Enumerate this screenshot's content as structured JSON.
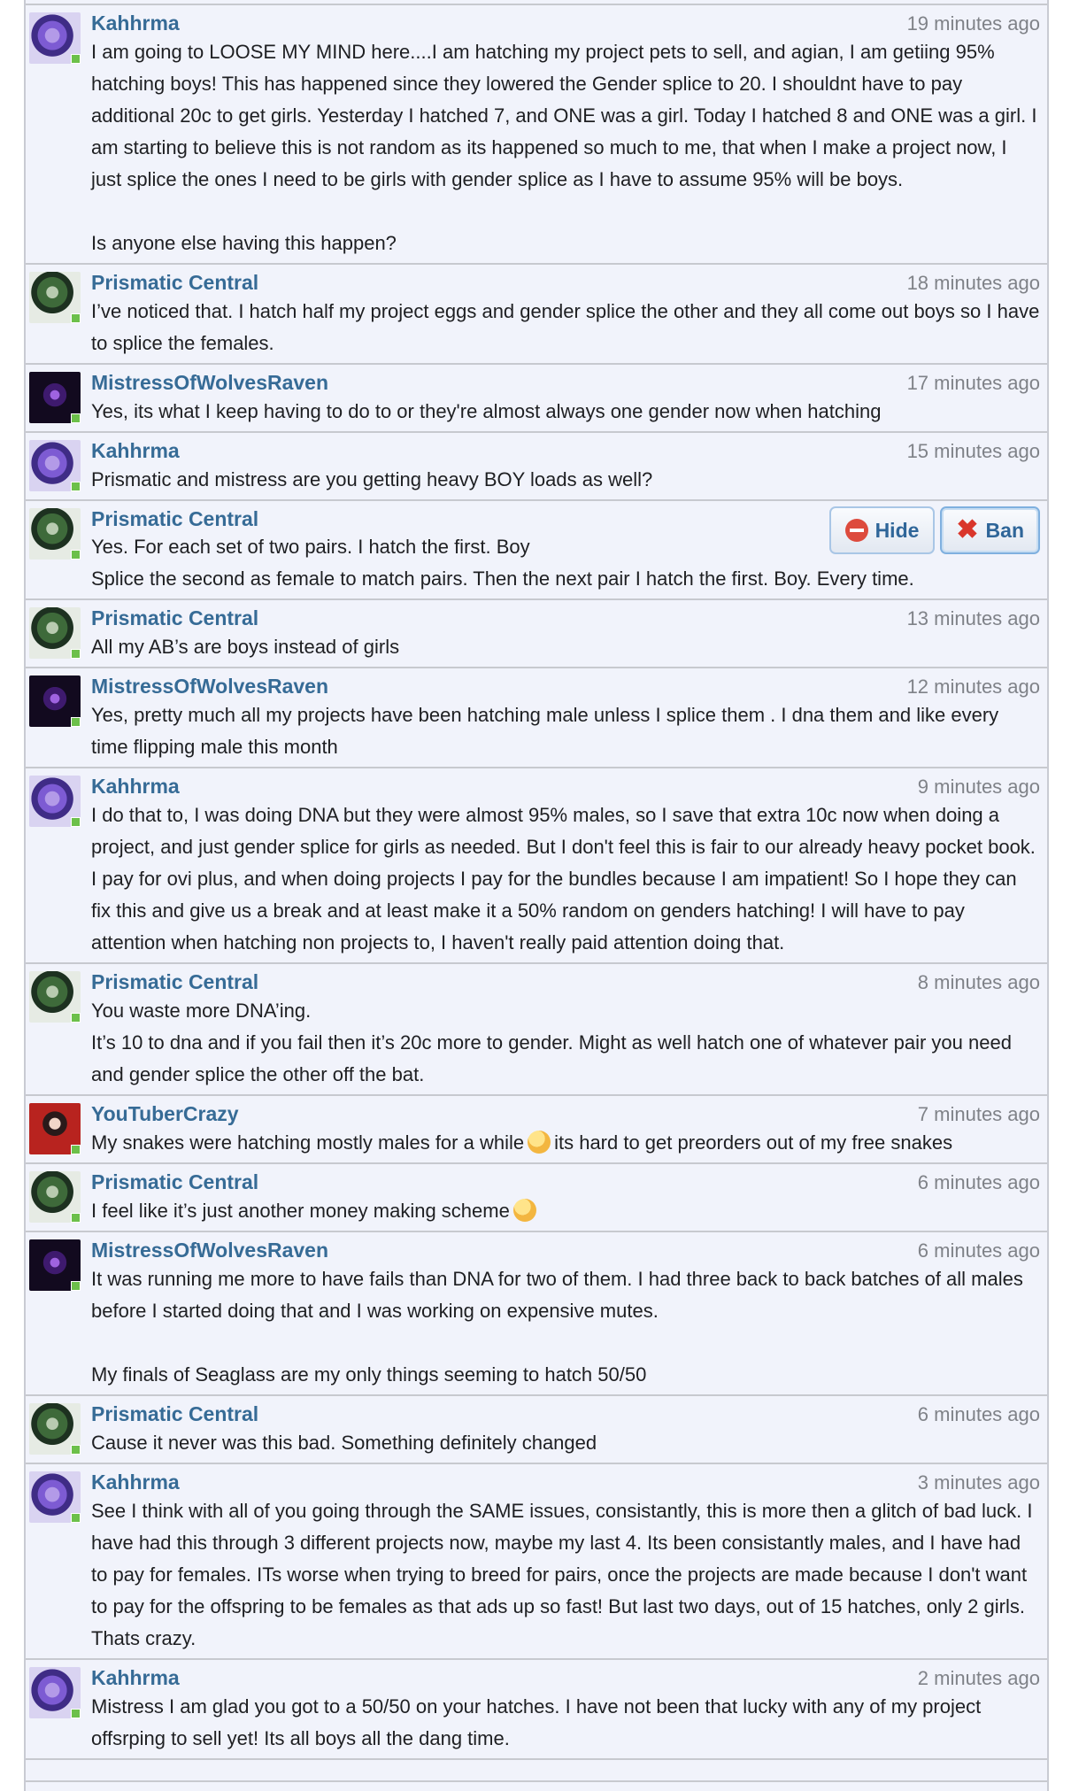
{
  "moderation": {
    "hide_label": "Hide",
    "ban_label": "Ban"
  },
  "messages": [
    {
      "user": "Kahhrma",
      "time": "19 minutes ago",
      "text": "I am going to LOOSE MY MIND here....I am hatching my project pets to sell, and agian, I am getiing 95% hatching boys! This has happened since they lowered the Gender splice to 20. I shouldnt have to pay additional 20c to get girls. Yesterday I hatched 7, and ONE was a girl. Today I hatched 8 and ONE was a girl. I am starting to believe this is not random as its happened so much to me, that when I make a project now, I just splice the ones I need to be girls with gender splice as I have to assume 95% will be boys.\n\nIs anyone else having this happen?"
    },
    {
      "user": "Prismatic Central",
      "time": "18 minutes ago",
      "text": "I’ve noticed that. I hatch half my project eggs and gender splice the other and they all come out boys so I have to splice the females."
    },
    {
      "user": "MistressOfWolvesRaven",
      "time": "17 minutes ago",
      "text": "Yes, its what I keep having to do to or they're almost always one gender now when hatching"
    },
    {
      "user": "Kahhrma",
      "time": "15 minutes ago",
      "text": "Prismatic and mistress are you getting heavy BOY loads as well?"
    },
    {
      "user": "Prismatic Central",
      "time": "",
      "text": "Yes. For each set of two pairs. I hatch the first. Boy\nSplice the second as female to match pairs. Then the next pair I hatch the first. Boy. Every time."
    },
    {
      "user": "Prismatic Central",
      "time": "13 minutes ago",
      "text": "All my AB’s are boys instead of girls"
    },
    {
      "user": "MistressOfWolvesRaven",
      "time": "12 minutes ago",
      "text": "Yes, pretty much all my projects have been hatching male unless I splice them . I dna them and like every time flipping male this month"
    },
    {
      "user": "Kahhrma",
      "time": "9 minutes ago",
      "text": "I do that to, I was doing DNA but they were almost 95% males, so I save that extra 10c now when doing a project, and just gender splice for girls as needed. But I don't feel this is fair to our already heavy pocket book. I pay for ovi plus, and when doing projects I pay for the bundles because I am impatient! So I hope they can fix this and give us a break and at least make it a 50% random on genders hatching! I will have to pay attention when hatching non projects to, I haven't really paid attention doing that."
    },
    {
      "user": "Prismatic Central",
      "time": "8 minutes ago",
      "text": "You waste more DNA’ing.\nIt’s 10 to dna and if you fail then it’s 20c more to gender. Might as well hatch one of whatever pair you need and gender splice the other off the bat."
    },
    {
      "user": "YouTuberCrazy",
      "time": "7 minutes ago",
      "text_a": "My snakes were hatching mostly males for a while",
      "text_b": "its hard to get preorders out of my free snakes"
    },
    {
      "user": "Prismatic Central",
      "time": "6 minutes ago",
      "text_a": "I feel like it’s just another money making scheme"
    },
    {
      "user": "MistressOfWolvesRaven",
      "time": "6 minutes ago",
      "text": "It was running me more to have fails than DNA for two of them. I had three back to back batches of all males before I started doing that and I was working on expensive mutes.\n\nMy finals of Seaglass are my only things seeming to hatch 50/50"
    },
    {
      "user": "Prismatic Central",
      "time": "6 minutes ago",
      "text": "Cause it never was this bad. Something definitely changed"
    },
    {
      "user": "Kahhrma",
      "time": "3 minutes ago",
      "text": "See I think with all of you going through the SAME issues, consistantly, this is more then a glitch of bad luck. I have had this through 3 different projects now, maybe my last 4. Its been consistantly males, and I have had to pay for females. ITs worse when trying to breed for pairs, once the projects are made because I don't want to pay for the offspring to be females as that ads up so fast! But last two days, out of 15 hatches, only 2 girls. Thats crazy."
    },
    {
      "user": "Kahhrma",
      "time": "2 minutes ago",
      "text": "Mistress I am glad you got to a 50/50 on your hatches. I have not been that lucky with any of my project offsrping to sell yet! Its all boys all the dang time."
    }
  ]
}
